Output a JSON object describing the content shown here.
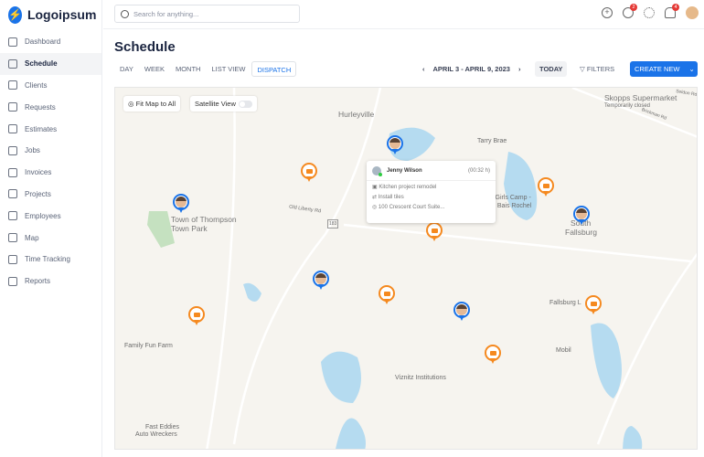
{
  "app": {
    "logo": "Logoipsum"
  },
  "sidebar": {
    "items": [
      {
        "label": "Dashboard"
      },
      {
        "label": "Schedule"
      },
      {
        "label": "Clients"
      },
      {
        "label": "Requests"
      },
      {
        "label": "Estimates"
      },
      {
        "label": "Jobs"
      },
      {
        "label": "Invoices"
      },
      {
        "label": "Projects"
      },
      {
        "label": "Employees"
      },
      {
        "label": "Map"
      },
      {
        "label": "Time Tracking"
      },
      {
        "label": "Reports"
      }
    ],
    "active": "Schedule"
  },
  "topbar": {
    "search_placeholder": "Search for anything...",
    "messages_badge": "2",
    "notifications_badge": "4"
  },
  "page": {
    "title": "Schedule"
  },
  "tabs": [
    {
      "label": "DAY"
    },
    {
      "label": "WEEK"
    },
    {
      "label": "MONTH"
    },
    {
      "label": "LIST VIEW"
    },
    {
      "label": "DISPATCH"
    }
  ],
  "toolbar": {
    "date_range": "APRIL 3 - APRIL 9, 2023",
    "prev": "‹",
    "next": "›",
    "today": "TODAY",
    "filters": "FILTERS",
    "create": "CREATE NEW"
  },
  "map": {
    "fit_label": "Fit Map to All",
    "satellite_label": "Satellite View",
    "satellite_on": false,
    "places": [
      "Hurleyville",
      "Tarry Brae",
      "Skopps Supermarket",
      "Temporarily closed",
      "Satmar Girls Camp -",
      "Machne Bais Rochel",
      "South",
      "Fallsburg",
      "Town of Thompson",
      "Town Park",
      "Family Fun Farm",
      "Viznitz Institutions",
      "Mobil",
      "Fast Eddies",
      "Auto Wreckers",
      "Fallsburg L",
      "Old Liberty Rd",
      "Seldon Rd",
      "Brickman Rd",
      "183"
    ],
    "popup": {
      "name": "Jenny Wilson",
      "duration": "(00:32 h)",
      "project": "Kitchen project remodel",
      "task": "Install tiles",
      "address": "100 Crescent Court Suite..."
    }
  }
}
